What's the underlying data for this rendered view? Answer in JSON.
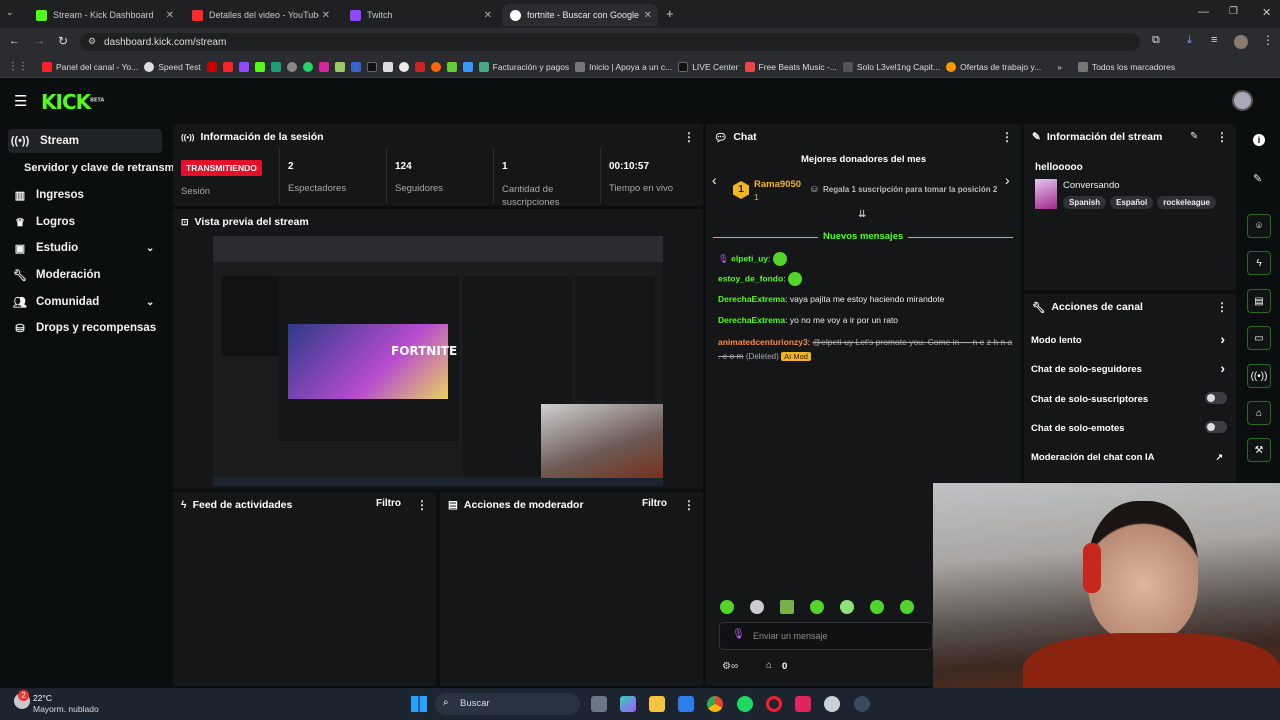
{
  "browser": {
    "tabs": [
      {
        "label": "Stream - Kick Dashboard",
        "active": false
      },
      {
        "label": "Detalles del video - YouTube St",
        "active": false
      },
      {
        "label": "Twitch",
        "active": false
      },
      {
        "label": "fortnite - Buscar con Google",
        "active": true
      }
    ],
    "url": "dashboard.kick.com/stream",
    "bookmarks": [
      "Panel del canal - Yo...",
      "Speed Test",
      "Facturación y pagos",
      "Inicio | Apoya a un c...",
      "LIVE Center",
      "Free Beats Music -...",
      "Solo L3vel1ng Capit...",
      "Ofertas de trabajo y...",
      "Todos los marcadores"
    ]
  },
  "kick": {
    "logo": "KICK",
    "logo_badge": "BETA",
    "nav": [
      {
        "label": "Stream",
        "icon": "stream-icon"
      },
      {
        "label": "Servidor y clave de retransm",
        "icon": ""
      },
      {
        "label": "Ingresos",
        "icon": "bank-icon"
      },
      {
        "label": "Logros",
        "icon": "trophy-icon"
      },
      {
        "label": "Estudio",
        "icon": "studio-icon"
      },
      {
        "label": "Moderación",
        "icon": "wrench-icon"
      },
      {
        "label": "Comunidad",
        "icon": "people-icon"
      },
      {
        "label": "Drops y recompensas",
        "icon": "gift-icon"
      }
    ]
  },
  "session": {
    "title": "Información de la sesión",
    "live_badge": "TRANSMITIENDO",
    "session_label": "Sesión",
    "stats": [
      {
        "value": "2",
        "label": "Espectadores"
      },
      {
        "value": "124",
        "label": "Seguidores"
      },
      {
        "value": "1",
        "label": "Cantidad de suscripciones"
      },
      {
        "value": "00:10:57",
        "label": "Tiempo en vivo"
      }
    ]
  },
  "preview": {
    "title": "Vista previa del stream",
    "game_title": "FORTNITE"
  },
  "feed": {
    "title": "Feed de actividades",
    "filter": "Filtro"
  },
  "modactions": {
    "title": "Acciones de moderador",
    "filter": "Filtro"
  },
  "chat": {
    "title": "Chat",
    "top_donors": "Mejores donadores del mes",
    "donor_rank": "1",
    "donor_name": "Rama9050",
    "donor_count": "1",
    "donor_cta": "Regala 1 suscripción para tomar la posición 2",
    "new_messages": "Nuevos mensajes",
    "messages": [
      {
        "user": "elpeti_uy",
        "text": ""
      },
      {
        "user": "estoy_de_fondo",
        "text": ""
      },
      {
        "user": "DerechaExtrema",
        "text": "vaya pajita me estoy haciendo mirandote"
      },
      {
        "user": "DerechaExtrema",
        "text": "yo no me voy a ir por un rato"
      }
    ],
    "deleted_user": "animatedcenturionzy3",
    "deleted_text_1": "@elpeti-uy Let's promote you. Come in — n e",
    "deleted_text_2": "z h n a . c o m",
    "deleted_label": "(Deleted)",
    "ai_mod": "AI Mod",
    "input_placeholder": "Enviar un mensaje",
    "viewer_count": "0"
  },
  "streaminfo": {
    "title": "Información del stream",
    "stream_title": "hellooooo",
    "category": "Conversando",
    "tags": [
      "Spanish",
      "Español",
      "rockeleague"
    ]
  },
  "channel_actions": {
    "title": "Acciones de canal",
    "items": [
      "Modo lento",
      "Chat de solo-seguidores",
      "Chat de solo-suscriptores",
      "Chat de solo-emotes",
      "Moderación del chat con IA"
    ]
  },
  "taskbar": {
    "weather_temp": "22°C",
    "weather_desc": "Mayorm. nublado",
    "search": "Buscar",
    "notification": "2"
  },
  "colors": {
    "accent": "#53fc18",
    "live": "#e4102a"
  }
}
